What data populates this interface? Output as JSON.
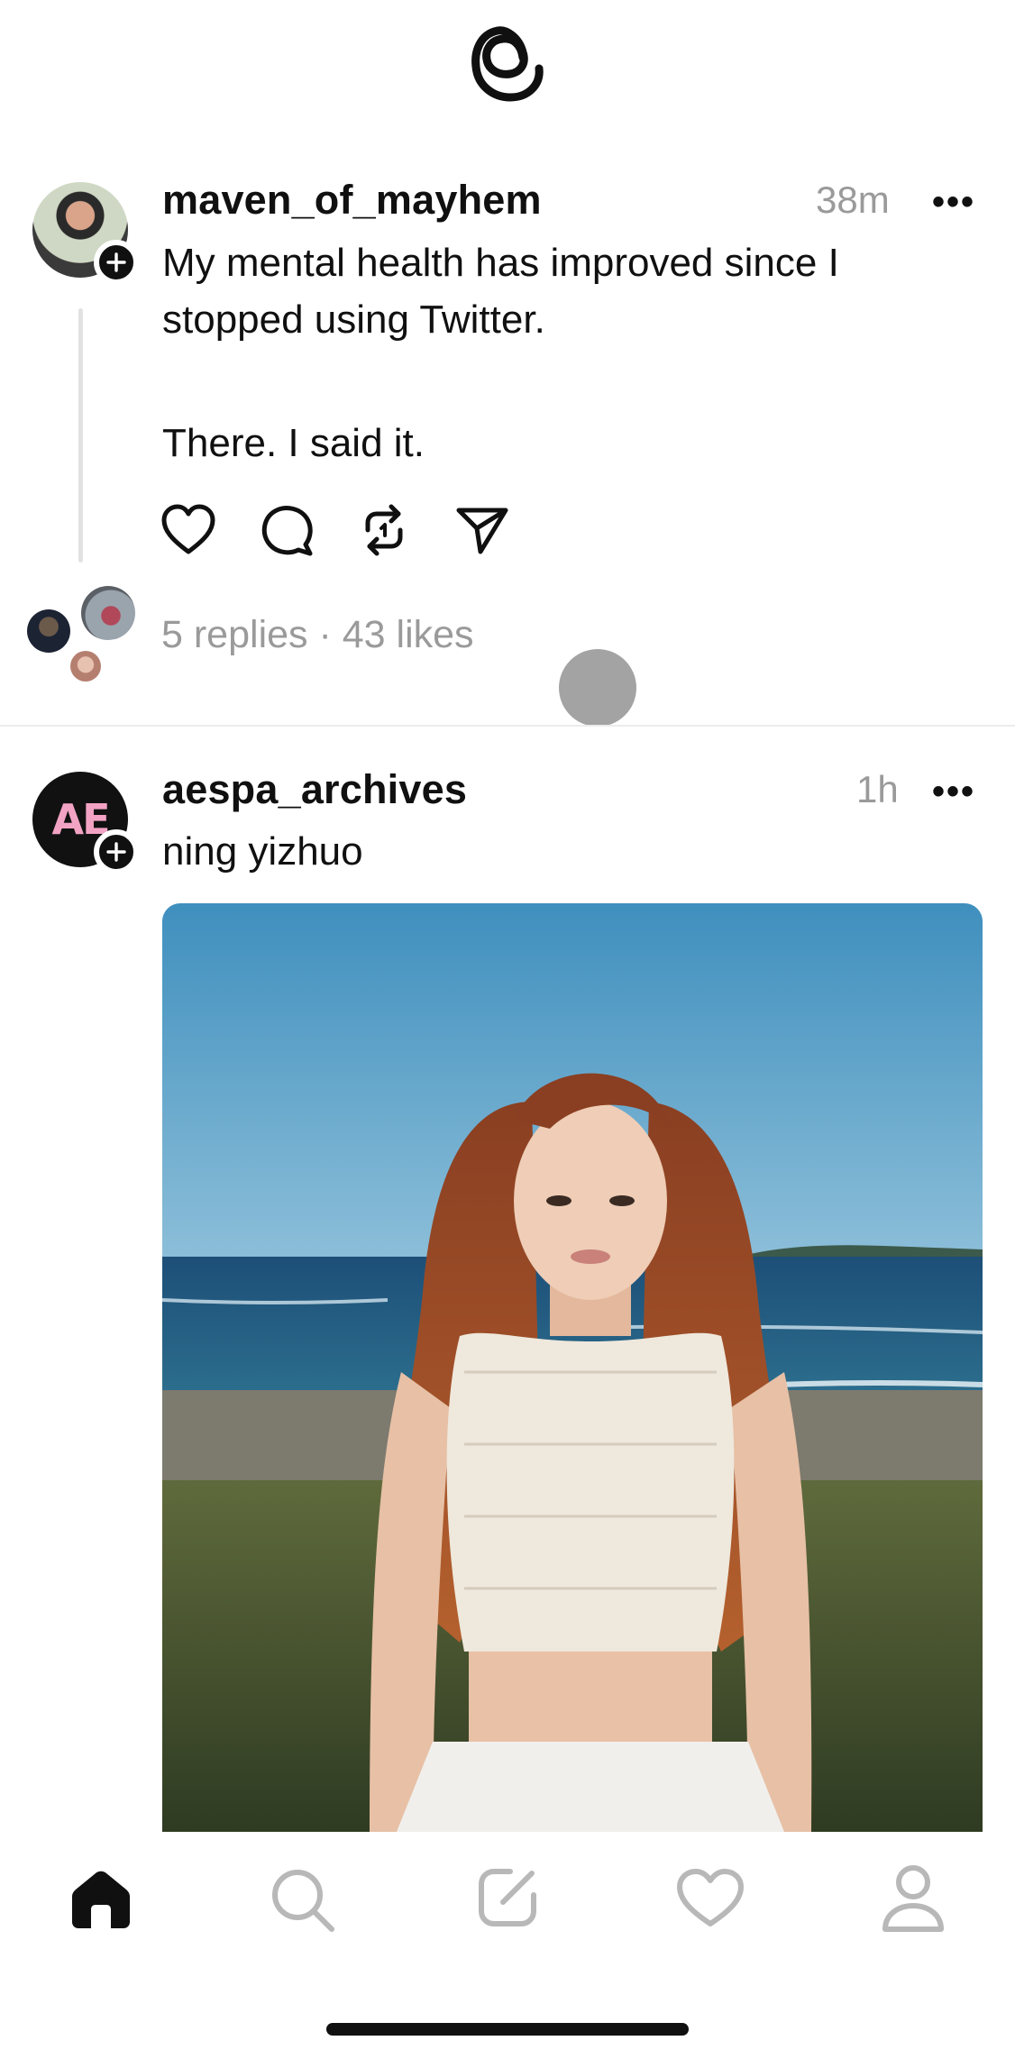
{
  "app": {
    "logo_icon": "threads-logo-icon"
  },
  "posts": [
    {
      "username": "maven_of_mayhem",
      "time": "38m",
      "more": "•••",
      "text_line1": "My mental health has improved since I",
      "text_line2": "stopped using Twitter.",
      "text_line3": "There. I said it.",
      "stats": "5 replies · 43 likes",
      "actions": [
        "heart-icon",
        "comment-icon",
        "repost-icon",
        "share-icon"
      ]
    },
    {
      "username": "aespa_archives",
      "avatar_initials": "AE",
      "time": "1h",
      "more": "•••",
      "text": "ning yizhuo",
      "image": "photo of a woman with long auburn hair in a white crochet top standing on a coastal meadow"
    }
  ],
  "tabbar": {
    "items": [
      "home-icon",
      "search-icon",
      "compose-icon",
      "activity-heart-icon",
      "profile-icon"
    ],
    "active": "home-icon"
  },
  "colors": {
    "text": "#101010",
    "muted": "#9a9a9a",
    "divider": "#ececec",
    "background": "#ffffff"
  }
}
